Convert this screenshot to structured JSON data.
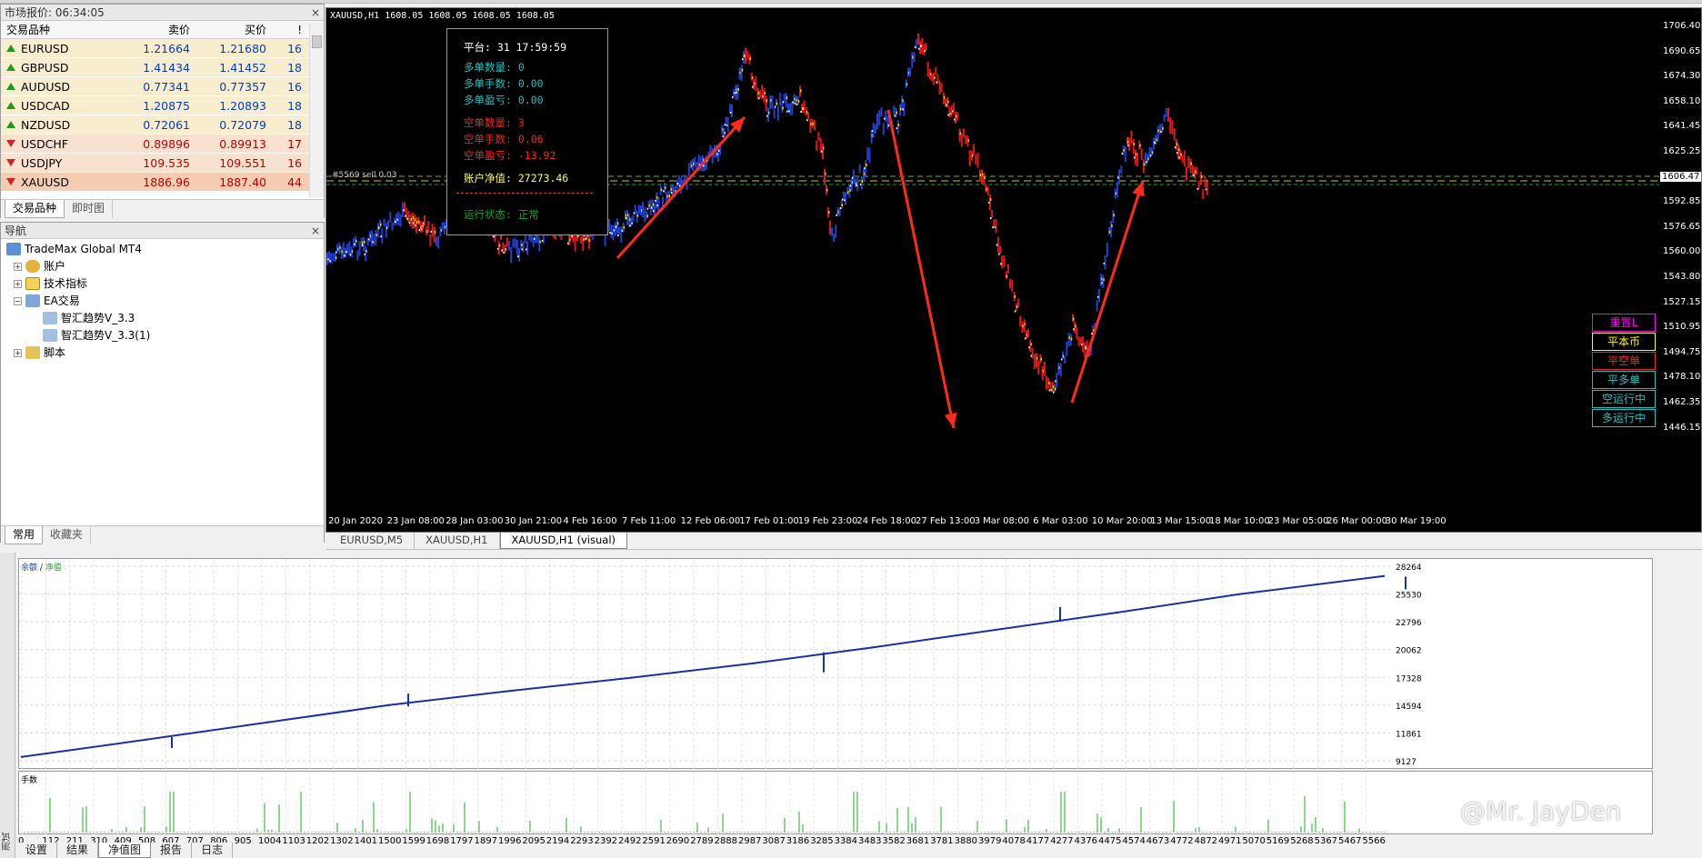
{
  "market_watch": {
    "title": "市场报价: 06:34:05",
    "columns": {
      "symbol": "交易品种",
      "bid": "卖价",
      "ask": "买价",
      "spread": "!"
    },
    "rows": [
      {
        "symbol": "EURUSD",
        "bid": "1.21664",
        "ask": "1.21680",
        "spread": "16",
        "dir": "up",
        "bg": "#f9edcf"
      },
      {
        "symbol": "GBPUSD",
        "bid": "1.41434",
        "ask": "1.41452",
        "spread": "18",
        "dir": "up",
        "bg": "#f9edcf"
      },
      {
        "symbol": "AUDUSD",
        "bid": "0.77341",
        "ask": "0.77357",
        "spread": "16",
        "dir": "up",
        "bg": "#f9edcf"
      },
      {
        "symbol": "USDCAD",
        "bid": "1.20875",
        "ask": "1.20893",
        "spread": "18",
        "dir": "up",
        "bg": "#f9edcf"
      },
      {
        "symbol": "NZDUSD",
        "bid": "0.72061",
        "ask": "0.72079",
        "spread": "18",
        "dir": "up",
        "bg": "#f9edcf"
      },
      {
        "symbol": "USDCHF",
        "bid": "0.89896",
        "ask": "0.89913",
        "spread": "17",
        "dir": "down",
        "bg": "#f9e1cf"
      },
      {
        "symbol": "USDJPY",
        "bid": "109.535",
        "ask": "109.551",
        "spread": "16",
        "dir": "down",
        "bg": "#f9e1cf"
      },
      {
        "symbol": "XAUUSD",
        "bid": "1886.96",
        "ask": "1887.40",
        "spread": "44",
        "dir": "down",
        "bg": "#f6cdb0"
      }
    ],
    "tabs": [
      "交易品种",
      "即时图"
    ]
  },
  "navigator": {
    "title": "导航",
    "items": [
      {
        "label": "TradeMax Global MT4",
        "level": 0
      },
      {
        "label": "账户",
        "level": 1
      },
      {
        "label": "技术指标",
        "level": 1
      },
      {
        "label": "EA交易",
        "level": 1
      },
      {
        "label": "智汇趋势V_3.3",
        "level": 2
      },
      {
        "label": "智汇趋势V_3.3(1)",
        "level": 2
      },
      {
        "label": "脚本",
        "level": 1
      }
    ],
    "tabs": [
      "常用",
      "收藏夹"
    ]
  },
  "chart": {
    "title": "XAUUSD,H1  1608.05 1608.05 1608.05 1608.05",
    "price_labels": [
      "1706.40",
      "1690.65",
      "1674.30",
      "1658.10",
      "1641.45",
      "1625.25",
      "1606.47",
      "1592.85",
      "1576.65",
      "1560.00",
      "1543.80",
      "1527.15",
      "1510.95",
      "1494.75",
      "1478.10",
      "1462.35",
      "1446.15"
    ],
    "current_price": "1606.47",
    "time_labels": [
      "20 Jan 2020",
      "23 Jan 08:00",
      "28 Jan 03:00",
      "30 Jan 21:00",
      "4 Feb 16:00",
      "7 Feb 11:00",
      "12 Feb 06:00",
      "17 Feb 01:00",
      "19 Feb 23:00",
      "24 Feb 18:00",
      "27 Feb 13:00",
      "3 Mar 08:00",
      "6 Mar 03:00",
      "10 Mar 20:00",
      "13 Mar 15:00",
      "18 Mar 10:00",
      "23 Mar 05:00",
      "26 Mar 00:00",
      "30 Mar 19:00"
    ],
    "line_label": "#5569 sell 0.03",
    "info": {
      "platform": "平台: 31 17:59:59",
      "long_count": "多单数量: 0",
      "long_lots": "多单手数: 0.00",
      "long_pnl": "多单盈亏: 0.00",
      "short_count": "空单数量: 3",
      "short_lots": "空单手数: 0.06",
      "short_pnl": "空单盈亏: -13.92",
      "equity": "账户净值: 27273.46",
      "status": "运行状态: 正常"
    },
    "buttons": [
      {
        "label": "重置L",
        "color": "#ff00ff"
      },
      {
        "label": "平本币",
        "color": "#ffff00"
      },
      {
        "label": "平空单",
        "color": "#ff2020"
      },
      {
        "label": "平多单",
        "color": "#20c0c0"
      },
      {
        "label": "空运行中",
        "color": "#20c0c0"
      },
      {
        "label": "多运行中",
        "color": "#20c0c0"
      }
    ],
    "tabs": [
      "EURUSD,M5",
      "XAUUSD,H1",
      "XAUUSD,H1 (visual)"
    ]
  },
  "equity_chart": {
    "legend_balance": "余额",
    "legend_sep": " / ",
    "legend_equity": "净值",
    "lots_label": "手数",
    "y_labels": [
      "28264",
      "25530",
      "22796",
      "20062",
      "17328",
      "14594",
      "11861",
      "9127"
    ],
    "x_labels": [
      "0",
      "112",
      "211",
      "310",
      "409",
      "508",
      "607",
      "707",
      "806",
      "905",
      "1004",
      "1103",
      "1202",
      "1302",
      "1401",
      "1500",
      "1599",
      "1698",
      "1797",
      "1897",
      "1996",
      "2095",
      "2194",
      "2293",
      "2392",
      "2492",
      "2591",
      "2690",
      "2789",
      "2888",
      "2987",
      "3087",
      "3186",
      "3285",
      "3384",
      "3483",
      "3582",
      "3681",
      "3781",
      "3880",
      "3979",
      "4078",
      "4177",
      "4277",
      "4376",
      "4475",
      "4574",
      "4673",
      "4772",
      "4872",
      "4971",
      "5070",
      "5169",
      "5268",
      "5367",
      "5467",
      "5566"
    ],
    "side_label": "测试"
  },
  "bottom_tabs": [
    "设置",
    "结果",
    "净值图",
    "报告",
    "日志"
  ],
  "watermark": "@Mr. JayDen",
  "chart_data": {
    "type": "line",
    "title": "",
    "x": [
      0,
      508,
      1004,
      1500,
      1996,
      2492,
      2987,
      3483,
      3979,
      4475,
      4971,
      5566
    ],
    "series": [
      {
        "name": "余额",
        "values": [
          9500,
          11200,
          12900,
          14600,
          16000,
          17300,
          18700,
          20300,
          22000,
          23700,
          25500,
          27300
        ]
      }
    ],
    "ylim": [
      9127,
      28264
    ],
    "xlabel": "",
    "ylabel": ""
  }
}
